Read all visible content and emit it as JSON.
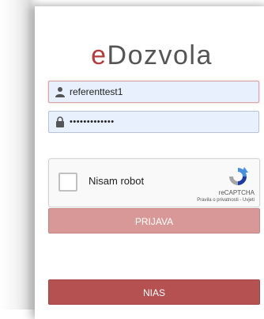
{
  "brand": {
    "first": "e",
    "rest": "Dozvola",
    "accent_color": "#b63b3b"
  },
  "form": {
    "username": {
      "value": "referenttest1",
      "icon": "user-icon"
    },
    "password": {
      "value": "•••••••••••••",
      "icon": "lock-icon"
    }
  },
  "captcha": {
    "label": "Nisam robot",
    "brand": "reCAPTCHA",
    "links": "Pravila o privatnosti - Uvjeti"
  },
  "buttons": {
    "login": "PRIJAVA",
    "nias": "NIAS"
  }
}
